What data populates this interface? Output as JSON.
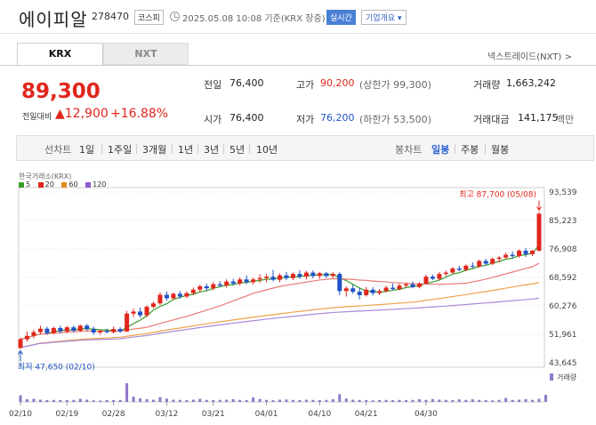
{
  "header": {
    "name": "에이피알",
    "code": "278470",
    "market": "코스피",
    "timestamp": "2025.05.08 10:08  기준(KRX 장중)",
    "realtime_label": "실시간",
    "company_label": "기업개요 ▾"
  },
  "tabs": {
    "krx": "KRX",
    "nxt": "NXT",
    "nextrade": "넥스트레이드(NXT) >"
  },
  "price": {
    "current": "89,300",
    "change_label": "전일대비",
    "change_abs": "▲12,900",
    "change_pct": "+16.88%"
  },
  "quote": {
    "prev_label": "전일",
    "prev": "76,400",
    "open_label": "시가",
    "open": "76,400",
    "high_label": "고가",
    "high": "90,200",
    "high_sub": "(상한가 99,300)",
    "low_label": "저가",
    "low": "76,200",
    "low_sub": "(하한가 53,500)",
    "volume_label": "거래량",
    "volume": "1,663,242",
    "amount_label": "거래대금",
    "amount": "141,175",
    "amount_unit": "백만"
  },
  "period_bar": {
    "line_label": "선차트",
    "periods": [
      "1일",
      "1주일",
      "3개월",
      "1년",
      "3년",
      "5년",
      "10년"
    ],
    "candle_label": "봉차트",
    "candles": [
      "일봉",
      "주봉",
      "월봉"
    ],
    "active_candle": "일봉"
  },
  "chart_meta": {
    "source": "한국거래소(KRX)",
    "ma": [
      {
        "label": "5",
        "color": "#3a9c2b"
      },
      {
        "label": "20",
        "color": "#e0261d"
      },
      {
        "label": "60",
        "color": "#e58a1f"
      },
      {
        "label": "120",
        "color": "#8b5bd1"
      }
    ],
    "high_label": "최고 87,700 (05/08)",
    "low_label": "최저 47,650 (02/10)",
    "volume_label": "거래량"
  },
  "chart_data": {
    "type": "candlestick",
    "title": "",
    "y_ticks": [
      93539,
      85223,
      76908,
      68592,
      60276,
      51961,
      43645
    ],
    "ylim": [
      43645,
      93539
    ],
    "x_ticks": [
      "02/10",
      "02/19",
      "02/28",
      "03/12",
      "03/21",
      "04/01",
      "04/10",
      "04/21",
      "04/30"
    ],
    "candles": [
      {
        "o": 48000,
        "h": 51000,
        "l": 47650,
        "c": 50500
      },
      {
        "o": 50500,
        "h": 52800,
        "l": 49800,
        "c": 51500
      },
      {
        "o": 51500,
        "h": 53300,
        "l": 50800,
        "c": 52600
      },
      {
        "o": 52600,
        "h": 54500,
        "l": 52000,
        "c": 53600
      },
      {
        "o": 53600,
        "h": 54200,
        "l": 51800,
        "c": 52300
      },
      {
        "o": 52300,
        "h": 54200,
        "l": 51900,
        "c": 53800
      },
      {
        "o": 53800,
        "h": 54500,
        "l": 52200,
        "c": 52800
      },
      {
        "o": 52800,
        "h": 54400,
        "l": 52300,
        "c": 54000
      },
      {
        "o": 54000,
        "h": 54500,
        "l": 52500,
        "c": 53000
      },
      {
        "o": 53000,
        "h": 54800,
        "l": 52600,
        "c": 54500
      },
      {
        "o": 54500,
        "h": 55000,
        "l": 53000,
        "c": 53500
      },
      {
        "o": 53500,
        "h": 54200,
        "l": 51800,
        "c": 52500
      },
      {
        "o": 52500,
        "h": 53400,
        "l": 51800,
        "c": 53000
      },
      {
        "o": 53000,
        "h": 53600,
        "l": 52200,
        "c": 52600
      },
      {
        "o": 52600,
        "h": 54200,
        "l": 52200,
        "c": 53500
      },
      {
        "o": 53500,
        "h": 54000,
        "l": 52400,
        "c": 52800
      },
      {
        "o": 52800,
        "h": 58800,
        "l": 52600,
        "c": 58000
      },
      {
        "o": 58000,
        "h": 59500,
        "l": 57000,
        "c": 58600
      },
      {
        "o": 58600,
        "h": 59800,
        "l": 56800,
        "c": 57500
      },
      {
        "o": 57500,
        "h": 60500,
        "l": 57000,
        "c": 60000
      },
      {
        "o": 60000,
        "h": 61500,
        "l": 59500,
        "c": 61000
      },
      {
        "o": 61000,
        "h": 64200,
        "l": 60500,
        "c": 63500
      },
      {
        "o": 63500,
        "h": 64500,
        "l": 61800,
        "c": 62500
      },
      {
        "o": 62500,
        "h": 64200,
        "l": 62000,
        "c": 63800
      },
      {
        "o": 63800,
        "h": 64600,
        "l": 62400,
        "c": 63000
      },
      {
        "o": 63000,
        "h": 64500,
        "l": 62500,
        "c": 64000
      },
      {
        "o": 64000,
        "h": 65600,
        "l": 63400,
        "c": 65000
      },
      {
        "o": 65000,
        "h": 66500,
        "l": 64200,
        "c": 66000
      },
      {
        "o": 66000,
        "h": 66800,
        "l": 64700,
        "c": 65400
      },
      {
        "o": 65400,
        "h": 67200,
        "l": 64800,
        "c": 66600
      },
      {
        "o": 66600,
        "h": 67500,
        "l": 65800,
        "c": 66200
      },
      {
        "o": 66200,
        "h": 68000,
        "l": 65600,
        "c": 67400
      },
      {
        "o": 67400,
        "h": 68200,
        "l": 66200,
        "c": 66800
      },
      {
        "o": 66800,
        "h": 68600,
        "l": 66200,
        "c": 68000
      },
      {
        "o": 68000,
        "h": 69200,
        "l": 66600,
        "c": 67200
      },
      {
        "o": 67200,
        "h": 68500,
        "l": 66500,
        "c": 68000
      },
      {
        "o": 68000,
        "h": 69500,
        "l": 67000,
        "c": 68400
      },
      {
        "o": 68400,
        "h": 69600,
        "l": 67200,
        "c": 68800
      },
      {
        "o": 68800,
        "h": 70800,
        "l": 67400,
        "c": 67900
      },
      {
        "o": 67900,
        "h": 69800,
        "l": 67200,
        "c": 69200
      },
      {
        "o": 69200,
        "h": 70200,
        "l": 67800,
        "c": 68400
      },
      {
        "o": 68400,
        "h": 70000,
        "l": 67800,
        "c": 69600
      },
      {
        "o": 69600,
        "h": 70700,
        "l": 68200,
        "c": 68800
      },
      {
        "o": 68800,
        "h": 70500,
        "l": 68000,
        "c": 70000
      },
      {
        "o": 70000,
        "h": 70600,
        "l": 68300,
        "c": 69000
      },
      {
        "o": 69000,
        "h": 70200,
        "l": 68200,
        "c": 69800
      },
      {
        "o": 69800,
        "h": 70200,
        "l": 68400,
        "c": 69000
      },
      {
        "o": 69000,
        "h": 70100,
        "l": 68400,
        "c": 69600
      },
      {
        "o": 69600,
        "h": 70100,
        "l": 63400,
        "c": 64600
      },
      {
        "o": 64600,
        "h": 66000,
        "l": 63000,
        "c": 65400
      },
      {
        "o": 65400,
        "h": 66400,
        "l": 63800,
        "c": 64400
      },
      {
        "o": 64400,
        "h": 65500,
        "l": 62200,
        "c": 63400
      },
      {
        "o": 63400,
        "h": 65800,
        "l": 63000,
        "c": 65000
      },
      {
        "o": 65000,
        "h": 65700,
        "l": 63300,
        "c": 64000
      },
      {
        "o": 64000,
        "h": 65200,
        "l": 63400,
        "c": 64600
      },
      {
        "o": 64600,
        "h": 66200,
        "l": 64200,
        "c": 65600
      },
      {
        "o": 65600,
        "h": 66800,
        "l": 64800,
        "c": 65200
      },
      {
        "o": 65200,
        "h": 66800,
        "l": 64800,
        "c": 66200
      },
      {
        "o": 66200,
        "h": 67000,
        "l": 65600,
        "c": 66600
      },
      {
        "o": 66600,
        "h": 67400,
        "l": 65400,
        "c": 65800
      },
      {
        "o": 65800,
        "h": 67200,
        "l": 65400,
        "c": 66800
      },
      {
        "o": 66800,
        "h": 69400,
        "l": 66500,
        "c": 68800
      },
      {
        "o": 68800,
        "h": 69400,
        "l": 67800,
        "c": 68200
      },
      {
        "o": 68200,
        "h": 70200,
        "l": 67800,
        "c": 69600
      },
      {
        "o": 69600,
        "h": 70600,
        "l": 69000,
        "c": 70000
      },
      {
        "o": 70000,
        "h": 71600,
        "l": 69600,
        "c": 71200
      },
      {
        "o": 71200,
        "h": 72000,
        "l": 70400,
        "c": 70800
      },
      {
        "o": 70800,
        "h": 72400,
        "l": 70400,
        "c": 72000
      },
      {
        "o": 72000,
        "h": 73000,
        "l": 71200,
        "c": 71800
      },
      {
        "o": 71800,
        "h": 73800,
        "l": 71400,
        "c": 73400
      },
      {
        "o": 73400,
        "h": 74000,
        "l": 72200,
        "c": 72600
      },
      {
        "o": 72600,
        "h": 74400,
        "l": 72200,
        "c": 74000
      },
      {
        "o": 74000,
        "h": 74800,
        "l": 73000,
        "c": 74400
      },
      {
        "o": 74400,
        "h": 75800,
        "l": 74000,
        "c": 75200
      },
      {
        "o": 75200,
        "h": 76200,
        "l": 74200,
        "c": 74800
      },
      {
        "o": 74800,
        "h": 76800,
        "l": 74400,
        "c": 76400
      },
      {
        "o": 76400,
        "h": 77200,
        "l": 74600,
        "c": 75400
      },
      {
        "o": 75400,
        "h": 76600,
        "l": 74800,
        "c": 76400
      },
      {
        "o": 76400,
        "h": 87700,
        "l": 76200,
        "c": 87200
      }
    ],
    "volume": [
      30,
      12,
      14,
      10,
      8,
      9,
      8,
      8,
      9,
      14,
      10,
      7,
      6,
      8,
      8,
      9,
      85,
      24,
      16,
      12,
      10,
      22,
      15,
      10,
      9,
      8,
      10,
      14,
      9,
      8,
      9,
      10,
      12,
      9,
      8,
      20,
      13,
      9,
      8,
      10,
      11,
      9,
      8,
      10,
      9,
      8,
      9,
      12,
      35,
      15,
      10,
      9,
      8,
      7,
      8,
      9,
      8,
      9,
      8,
      9,
      12,
      9,
      13,
      10,
      9,
      8,
      11,
      9,
      12,
      9,
      8,
      7,
      9,
      18,
      9,
      10,
      12,
      9,
      14,
      32
    ],
    "ma5_end": 77800,
    "ma20_end": 71200,
    "ma60_end": 64800,
    "ma120_end": 58200
  }
}
